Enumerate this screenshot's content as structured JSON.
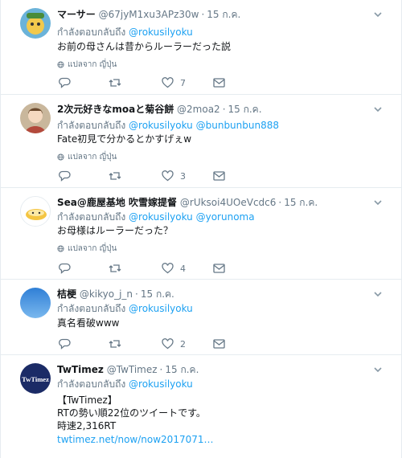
{
  "colors": {
    "accent": "#1da1f2",
    "muted": "#657786",
    "text": "#14171a",
    "divider": "#e6ecf0"
  },
  "translate_label": "แปลจาก ญี่ปุ่น",
  "reply_prefix": "กำลังตอบกลับถึง",
  "tweets": [
    {
      "name": "マーサー",
      "handle": "@67jyM1xu3APz30w",
      "time": "15 ก.ค.",
      "mentions": [
        "@rokusilyoku"
      ],
      "text": "お前の母さんは昔からルーラーだった説",
      "likes": "7",
      "avatar_colors": [
        "#6bb3d9",
        "#f2c94c"
      ]
    },
    {
      "name": "2次元好きなmoaと菊谷餅",
      "handle": "@2moa2",
      "time": "15 ก.ค.",
      "mentions": [
        "@rokusilyoku",
        "@bunbunbun888"
      ],
      "text": "Fate初見で分かるとかすげぇw",
      "likes": "3",
      "avatar_colors": [
        "#c9b79c",
        "#b34a3c"
      ]
    },
    {
      "name": "Sea@鹿屋基地 吹雪嫁提督",
      "handle": "@rUksoi4UOeVcdc6",
      "time": "15 ก.ค.",
      "mentions": [
        "@rokusilyoku",
        "@yorunoma"
      ],
      "text": "お母様はルーラーだった？",
      "likes": "4",
      "avatar_colors": [
        "#ffffff",
        "#f4c542"
      ]
    },
    {
      "name": "桔梗",
      "handle": "@kikyo_j_n",
      "time": "15 ก.ค.",
      "mentions": [
        "@rokusilyoku"
      ],
      "text": "真名看破www",
      "likes": "2",
      "avatar_colors": [
        "#2f7fd6",
        "#7ab8ee"
      ]
    },
    {
      "name": "TwTimez",
      "handle": "@TwTimez",
      "time": "15 ก.ค.",
      "mentions": [
        "@rokusilyoku"
      ],
      "lines": [
        "【TwTimez】",
        "RTの勢い順22位のツイートです。",
        "時速2,316RT"
      ],
      "link": "twtimez.net/now/now2017071…",
      "avatar_text": "TwTimez",
      "avatar_colors": [
        "#1b2b66",
        "#ffffff"
      ]
    }
  ]
}
